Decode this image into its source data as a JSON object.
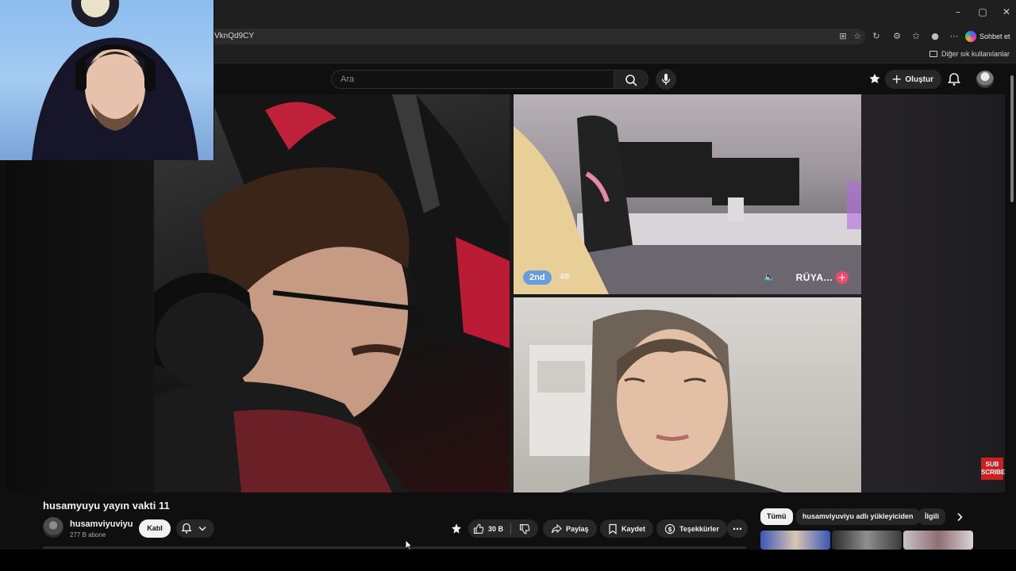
{
  "browser": {
    "url_fragment": "VknQd9CY",
    "copilot_label": "Sohbet et",
    "other_bookmarks_label": "Diğer sık kullanılanlar",
    "window_controls": [
      "–",
      "▢",
      "✕"
    ]
  },
  "header": {
    "search_placeholder": "Ara",
    "create_label": "Oluştur",
    "icons": [
      "premium-icon",
      "bell-icon",
      "avatar"
    ]
  },
  "video": {
    "title": "husamyuyu yayın vakti 11",
    "overlay": {
      "rank_badge": "2nd",
      "rank_count": "48",
      "user_name": "RÜYA...",
      "sub_badge": "SUB SCRIBE"
    }
  },
  "channel": {
    "name": "husamviyuviyu",
    "subscribers": "277 B abone",
    "join_label": "Katıl"
  },
  "actions": {
    "like_count": "30 B",
    "share_label": "Paylaş",
    "save_label": "Kaydet",
    "thanks_label": "Teşekkürler"
  },
  "chips": [
    "Tümü",
    "husamviyuviyu adlı yükleyiciden",
    "İlgili"
  ],
  "colors": {
    "background": "#0f0f0f",
    "pill": "#272727",
    "subscribe_red": "#cc1f1f",
    "rank_badge_blue": "#5a96e6"
  }
}
